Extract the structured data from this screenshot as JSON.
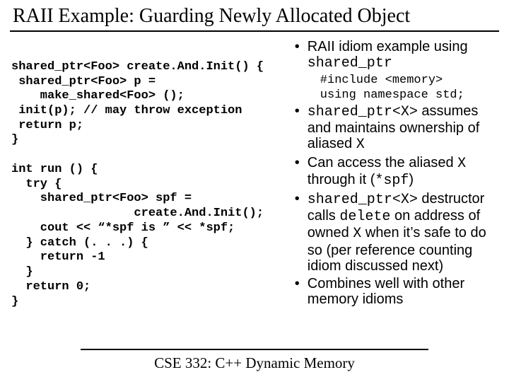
{
  "title": "RAII Example: Guarding Newly Allocated Object",
  "code": "shared_ptr<Foo> create.And.Init() {\n shared_ptr<Foo> p =\n    make_shared<Foo> ();\n init(p); // may throw exception\n return p;\n}\n\nint run () {\n  try {\n    shared_ptr<Foo> spf =\n                 create.And.Init();\n    cout << “*spf is ” << *spf;\n  } catch (. . .) {\n    return -1\n  }\n  return 0;\n}",
  "bullets": {
    "b1a": "RAII idiom example using ",
    "b1b": "shared_ptr",
    "sub1": "#include <memory>",
    "sub2": "using namespace std;",
    "b2a": "shared_ptr<X>",
    "b2b": " assumes and maintains ownership of aliased ",
    "b2c": "X",
    "b3a": "Can access the aliased ",
    "b3b": "X",
    "b3c": " through it (",
    "b3d": "*spf",
    "b3e": ")",
    "b4a": "shared_ptr<X>",
    "b4b": " destructor calls ",
    "b4c": "delete",
    "b4d": " on address of owned ",
    "b4e": "X",
    "b4f": " when it’s safe to do so (per reference counting idiom discussed next)",
    "b5": "Combines well with other memory idioms"
  },
  "footer": "CSE 332: C++ Dynamic Memory"
}
